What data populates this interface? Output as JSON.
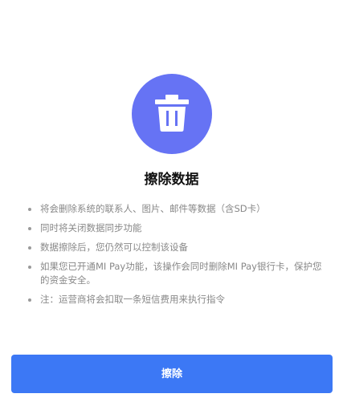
{
  "icon": {
    "name": "trash-icon",
    "circle_color": "#6673f4",
    "glyph_color": "#ffffff"
  },
  "title": "擦除数据",
  "notes": [
    "将会删除系统的联系人、图片、邮件等数据（含SD卡）",
    "同时将关闭数据同步功能",
    "数据擦除后，您仍然可以控制该设备",
    "如果您已开通MI Pay功能，该操作会同时删除MI Pay银行卡，保护您的资金安全。",
    "注：运营商将会扣取一条短信费用来执行指令"
  ],
  "erase_button": {
    "label": "擦除",
    "color": "#3c78f5"
  }
}
